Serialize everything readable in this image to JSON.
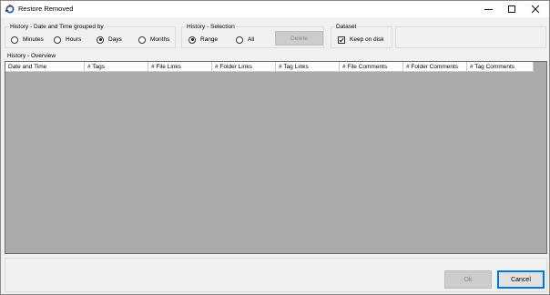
{
  "window": {
    "title": "Restore Removed",
    "controls": {
      "minimize": "minimize-icon",
      "maximize": "maximize-icon",
      "close": "close-icon"
    },
    "icon": "app-logo-icon"
  },
  "date_group": {
    "legend": "History - Date and Time grouped by",
    "options": [
      {
        "label": "Minutes",
        "selected": false
      },
      {
        "label": "Hours",
        "selected": false
      },
      {
        "label": "Days",
        "selected": true
      },
      {
        "label": "Months",
        "selected": false
      }
    ]
  },
  "selection_group": {
    "legend": "History - Selection",
    "options": [
      {
        "label": "Range",
        "selected": true
      },
      {
        "label": "All",
        "selected": false
      }
    ],
    "delete_label": "Delete",
    "delete_enabled": false
  },
  "dataset_group": {
    "legend": "Dataset",
    "keep_on_disk_label": "Keep on disk",
    "keep_on_disk_checked": true
  },
  "overview": {
    "label": "History - Overview",
    "columns": [
      "Date and Time",
      "# Tags",
      "# File Links",
      "# Folder Links",
      "# Tag Links",
      "# File Comments",
      "# Folder Comments",
      "# Tag Comments"
    ],
    "rows": []
  },
  "footer": {
    "ok_label": "Ok",
    "ok_enabled": false,
    "cancel_label": "Cancel"
  },
  "colors": {
    "grid_background": "#ababab",
    "focus_border": "#0078d7",
    "disabled_button": "#cccccc",
    "logo_blue": "#1c4fa3",
    "logo_red": "#d23a3a"
  }
}
